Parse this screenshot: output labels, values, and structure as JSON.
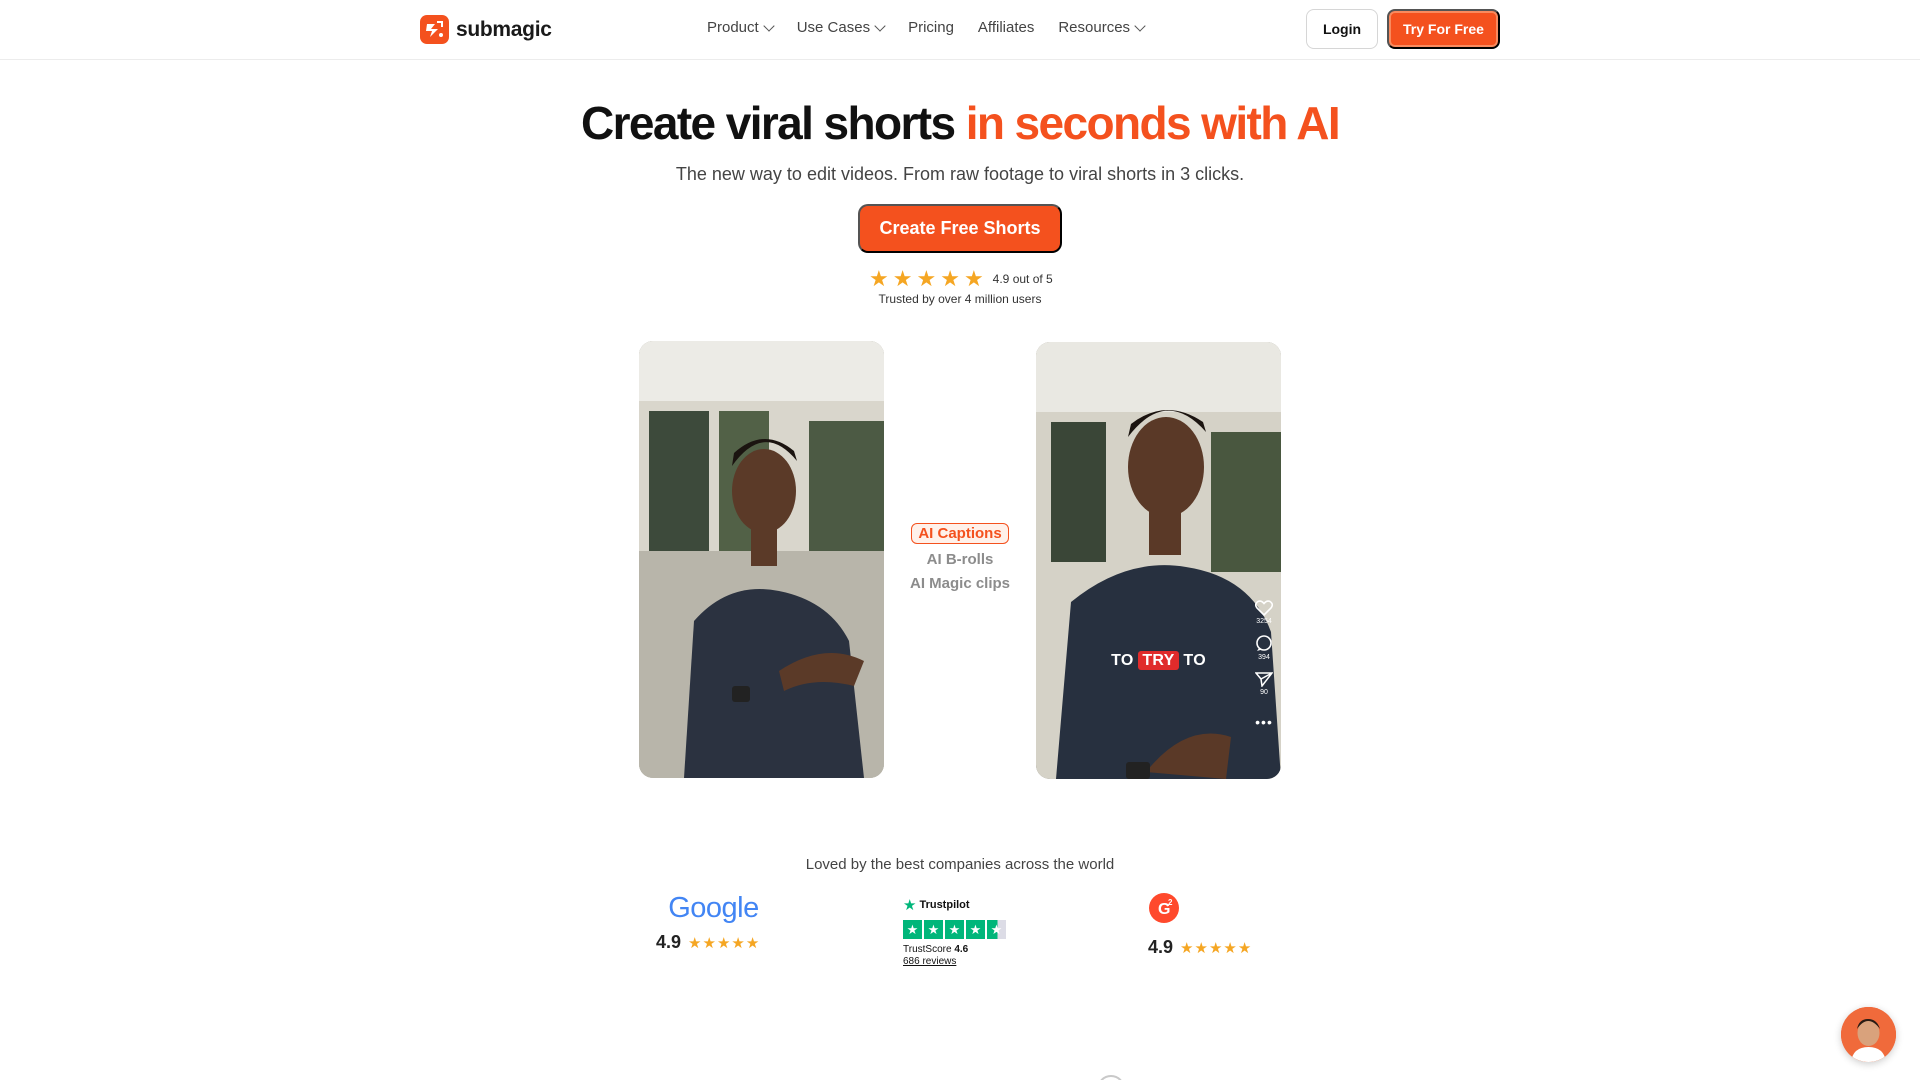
{
  "brand": {
    "name": "submagic",
    "accent_color": "#f4511e"
  },
  "nav": {
    "items": [
      {
        "label": "Product",
        "dropdown": true
      },
      {
        "label": "Use Cases",
        "dropdown": true
      },
      {
        "label": "Pricing",
        "dropdown": false
      },
      {
        "label": "Affiliates",
        "dropdown": false
      },
      {
        "label": "Resources",
        "dropdown": true
      }
    ],
    "login_label": "Login",
    "try_label": "Try For Free"
  },
  "hero": {
    "title_main": "Create viral shorts ",
    "title_accent": "in seconds with AI",
    "subtitle": "The new way to edit videos. From raw footage to viral shorts in 3 clicks.",
    "cta_label": "Create Free Shorts",
    "rating_text": "4.9 out of 5",
    "trusted_text": "Trusted by over 4 million users",
    "star_color": "#f5a623"
  },
  "demo": {
    "features": [
      {
        "label": "AI Captions",
        "active": true
      },
      {
        "label": "AI B-rolls",
        "active": false
      },
      {
        "label": "AI Magic clips",
        "active": false
      }
    ],
    "caption_words": [
      "TO",
      "TRY",
      "TO"
    ],
    "overlay": {
      "likes": "3254",
      "comments": "394",
      "shares": "90"
    }
  },
  "reviews": {
    "headline": "Loved by the best companies across the world",
    "google": {
      "name": "Google",
      "score": "4.9"
    },
    "trustpilot": {
      "name": "Trustpilot",
      "trustscore_label": "TrustScore",
      "trustscore_value": "4.6",
      "reviews_link": "686 reviews"
    },
    "g2": {
      "name": "G2",
      "score": "4.9"
    }
  }
}
